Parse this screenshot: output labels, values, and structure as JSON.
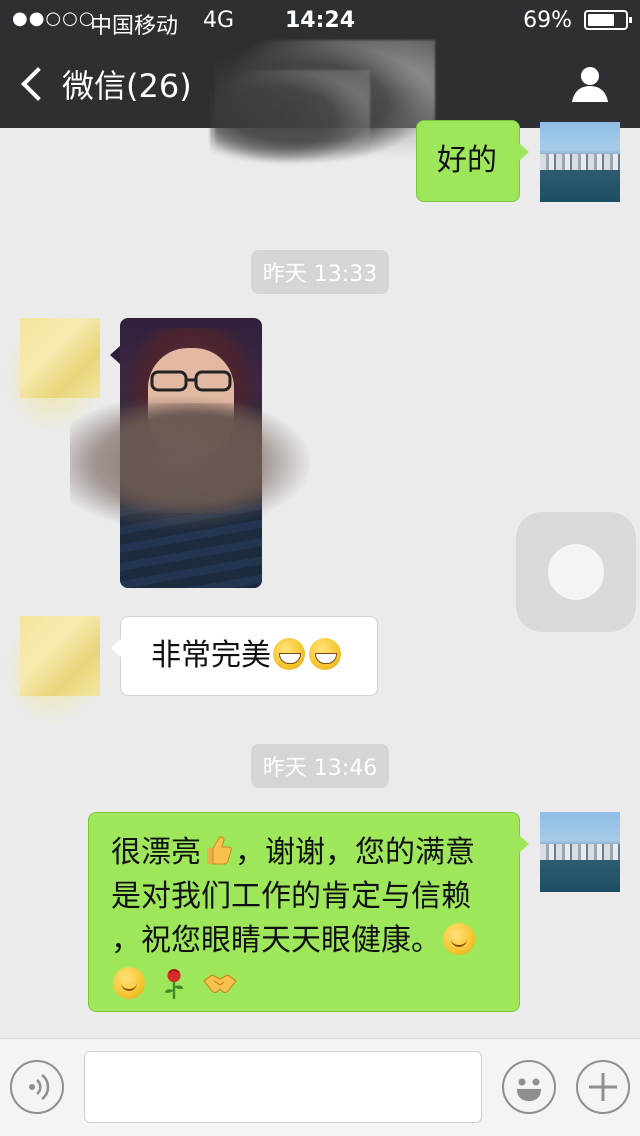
{
  "status_bar": {
    "signal": "●●○○○",
    "carrier": "中国移动",
    "network": "4G",
    "time": "14:24",
    "battery_percent": "69%",
    "battery_level": 0.69
  },
  "nav": {
    "back_label": "微信(26)"
  },
  "messages": {
    "m1": {
      "text": "好的"
    },
    "t1": {
      "text": "昨天 13:33"
    },
    "m3": {
      "text": "非常完美"
    },
    "t2": {
      "text": "昨天 13:46"
    },
    "m4": {
      "line1": "很漂亮",
      "line1b": "，谢谢，您的满意",
      "line2": "是对我们工作的肯定与信赖",
      "line3": "，祝您眼睛天天眼健康。"
    }
  },
  "icons": {
    "back": "chevron-left-icon",
    "profile": "person-icon",
    "voice": "voice-icon",
    "emoji": "smiley-icon",
    "add": "plus-icon"
  },
  "colors": {
    "nav_bg": "#2d2f33",
    "chat_bg": "#ebebeb",
    "bubble_sent": "#9fe75a",
    "bubble_received": "#ffffff",
    "timestamp_bg": "#d5d5d5"
  }
}
